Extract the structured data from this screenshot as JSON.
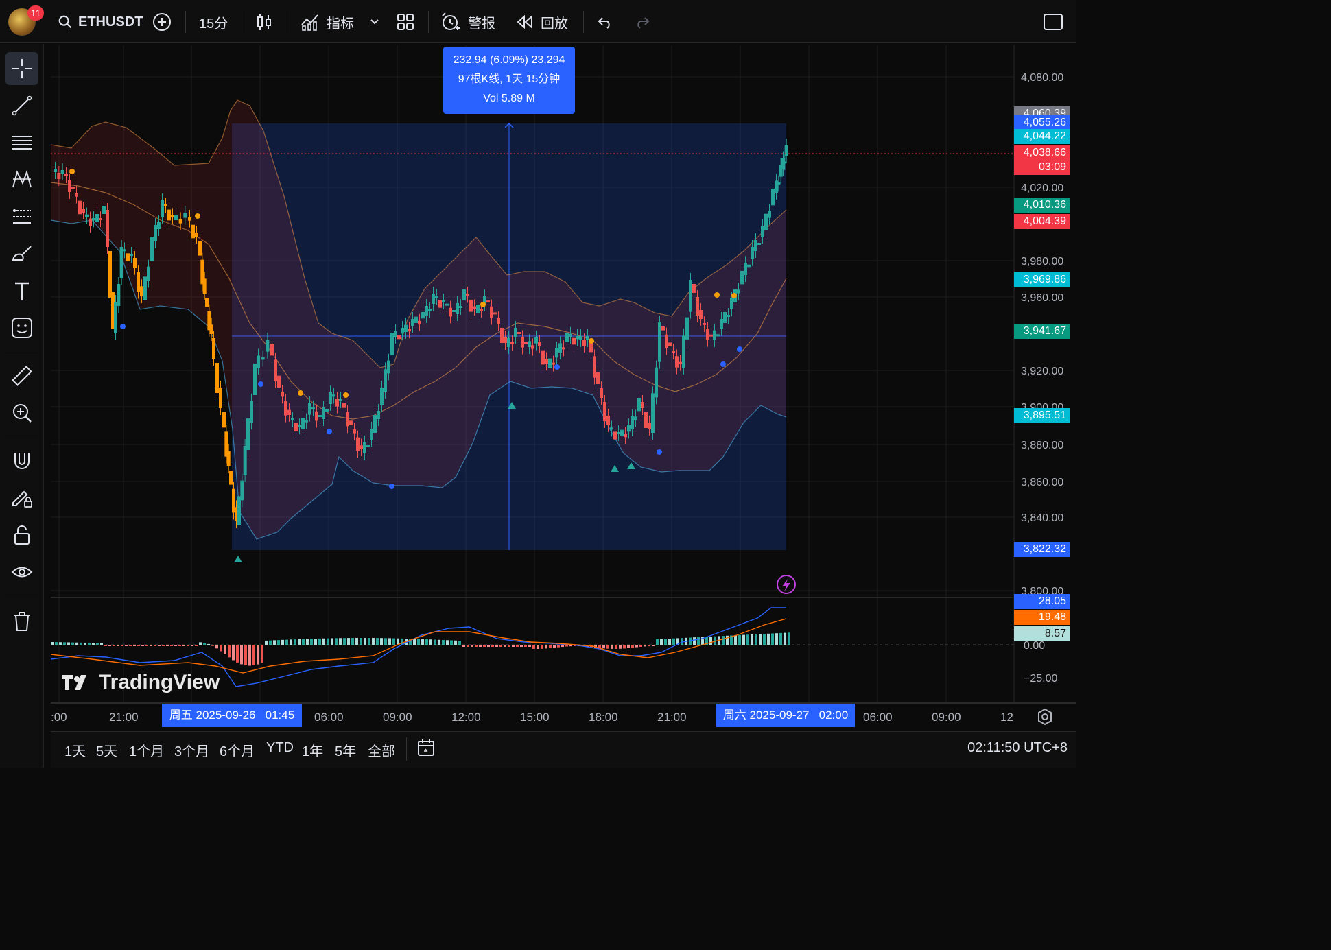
{
  "topbar": {
    "notif_count": "11",
    "symbol": "ETHUSDT",
    "interval": "15分",
    "indicators_label": "指标",
    "alerts_label": "警报",
    "replay_label": "回放"
  },
  "tooltip": {
    "line1": "232.94 (6.09%) 23,294",
    "line2": "97根K线, 1天 15分钟",
    "line3": "Vol 5.89 M"
  },
  "price_axis": {
    "ticks": [
      "4,080.00",
      "4,020.00",
      "3,980.00",
      "3,960.00",
      "3,920.00",
      "3,900.00",
      "3,880.00",
      "3,860.00",
      "3,840.00",
      "3,800.00"
    ],
    "tags": [
      {
        "text": "4,060.39",
        "color": "#787b86"
      },
      {
        "text": "4,055.26",
        "color": "#2962ff"
      },
      {
        "text": "4,044.22",
        "color": "#00bcd4"
      },
      {
        "text": "4,038.66",
        "color": "#f23645"
      },
      {
        "text": "03:09",
        "color": "#f23645"
      },
      {
        "text": "4,010.36",
        "color": "#089981"
      },
      {
        "text": "4,004.39",
        "color": "#f23645"
      },
      {
        "text": "3,969.86",
        "color": "#00bcd4"
      },
      {
        "text": "3,941.67",
        "color": "#089981"
      },
      {
        "text": "3,895.51",
        "color": "#00bcd4"
      },
      {
        "text": "3,822.32",
        "color": "#2962ff"
      }
    ]
  },
  "macd_axis": {
    "ticks": [
      "0.00",
      "−25.00"
    ],
    "tags": [
      {
        "text": "28.05",
        "color": "#2962ff"
      },
      {
        "text": "19.48",
        "color": "#ff6d00"
      },
      {
        "text": "8.57",
        "color": "#b2dfdb"
      }
    ]
  },
  "time_axis": {
    "ticks": [
      ":00",
      "21:00",
      "06:00",
      "09:00",
      "12:00",
      "15:00",
      "18:00",
      "21:00",
      "06:00",
      "09:00",
      "12"
    ],
    "range_start": "周五 2025-09-26   01:45",
    "range_end": "周六 2025-09-27   02:00"
  },
  "watermark": "TradingView",
  "bottombar": {
    "ranges": [
      "1天",
      "5天",
      "1个月",
      "3个月",
      "6个月",
      "YTD",
      "1年",
      "5年",
      "全部"
    ],
    "clock": "02:11:50 UTC+8"
  },
  "colors": {
    "up": "#26a69a",
    "down": "#ef5350",
    "accent": "#2962ff",
    "orange": "#ff9800"
  }
}
